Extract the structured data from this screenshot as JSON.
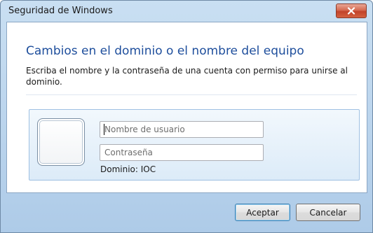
{
  "window": {
    "title": "Seguridad de Windows"
  },
  "dialog": {
    "heading": "Cambios en el dominio o el nombre del equipo",
    "description": "Escriba el nombre y la contraseña de una cuenta con permiso para unirse al dominio."
  },
  "credentials": {
    "username": {
      "value": "",
      "placeholder": "Nombre de usuario"
    },
    "password": {
      "value": "",
      "placeholder": "Contraseña"
    },
    "domain_label": "Dominio: IOC"
  },
  "buttons": {
    "accept_label": "Aceptar",
    "cancel_label": "Cancelar"
  },
  "icons": {
    "close": "close-icon",
    "user_tile": "user-tile-icon"
  },
  "colors": {
    "heading": "#1e4e9c",
    "close_button": "#c2432a",
    "frame": "#b9d3ec"
  }
}
